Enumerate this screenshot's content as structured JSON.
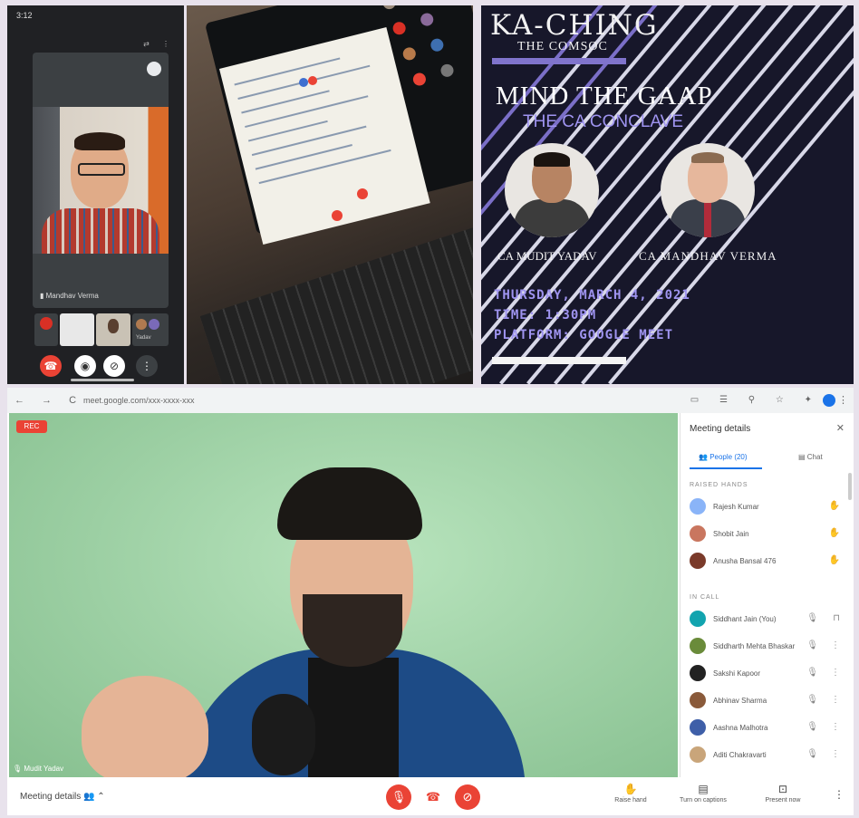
{
  "phone": {
    "time": "3:12",
    "battery": "",
    "meeting_code": "",
    "top_icons": "⇄ ⋮",
    "participant_label": "Mandhav Verma",
    "thumb_labels": [
      "",
      "",
      "",
      "Yadav"
    ],
    "controls": [
      "end-call",
      "mic",
      "camera",
      "more"
    ]
  },
  "poster": {
    "brand": "KA-CHING",
    "brand_sub": "THE COMSOC",
    "title": "MIND THE GAAP",
    "subtitle": "THE CA CONCLAVE",
    "speaker1": "CA MUDIT YADAV",
    "speaker2": "CA MANDHAV VERMA",
    "date_line": "THURSDAY, MARCH 4, 2021",
    "time_line": "TIME: 1:30PM",
    "platform_line": "PLATFORM: GOOGLE MEET",
    "colors": {
      "bg": "#17172a",
      "accent": "#8074cc",
      "text": "#f2f2f2"
    }
  },
  "meet": {
    "nav": "← → C",
    "url": "meet.google.com/xxx-xxxx-xxx",
    "toolbar_icons": "▭ ☰ ⚲ ☆ ✦",
    "rec_label": "REC",
    "self_label": "Mudit Yadav",
    "meeting_details": "Meeting details",
    "bottom_actions": [
      {
        "icon": "✋",
        "label": "Raise hand"
      },
      {
        "icon": "▤",
        "label": "Turn on captions"
      },
      {
        "icon": "⊡",
        "label": "Present now"
      }
    ],
    "panel": {
      "title": "Meeting details",
      "tab_people": "People (20)",
      "tab_chat": "Chat",
      "section_raised": "RAISED HANDS",
      "section_in_call": "IN CALL",
      "raised": [
        {
          "name": "Rajesh Kumar",
          "color": "#8ab4f8"
        },
        {
          "name": "Shobit Jain",
          "color": "#c9765f"
        },
        {
          "name": "Anusha Bansal 476",
          "color": "#7a3a2a"
        }
      ],
      "in_call": [
        {
          "name": "Siddhant Jain (You)",
          "color": "#12a4af"
        },
        {
          "name": "Siddharth Mehta Bhaskar",
          "color": "#6a8b3a"
        },
        {
          "name": "Sakshi Kapoor",
          "color": "#222222"
        },
        {
          "name": "Abhinav Sharma",
          "color": "#8a5a3a"
        },
        {
          "name": "Aashna Malhotra",
          "color": "#3e5fa8"
        },
        {
          "name": "Aditi Chakravarti",
          "color": "#c9a57a"
        }
      ]
    },
    "colors": {
      "red": "#ea4335",
      "blue": "#1a73e8"
    }
  }
}
